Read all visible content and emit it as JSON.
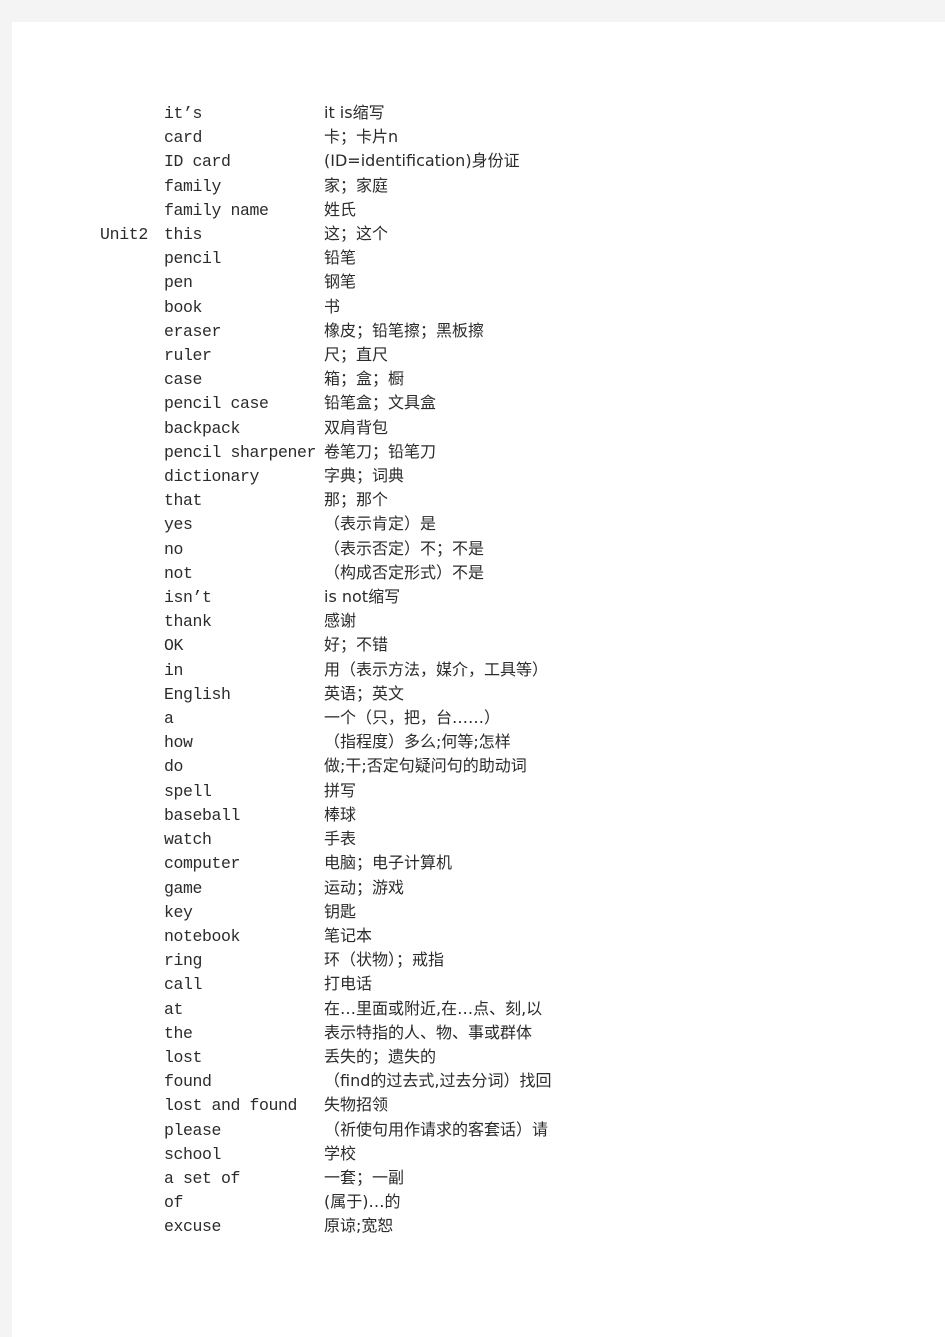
{
  "document": {
    "type": "vocabulary-list",
    "columns": [
      "unit",
      "word",
      "meaning"
    ],
    "page_background": "#ffffff",
    "surround_background": "#f4f4f4",
    "text_color": "#2b2b2b"
  },
  "rows": [
    {
      "unit": "",
      "word": "it’s",
      "meaning": "it is缩写"
    },
    {
      "unit": "",
      "word": "card",
      "meaning": "卡；卡片n"
    },
    {
      "unit": "",
      "word": "ID card",
      "meaning": "(ID=identification)身份证"
    },
    {
      "unit": "",
      "word": "family",
      "meaning": "家；家庭"
    },
    {
      "unit": "",
      "word": "family name",
      "meaning": "姓氏"
    },
    {
      "unit": "Unit2",
      "word": "this",
      "meaning": "这；这个"
    },
    {
      "unit": "",
      "word": "pencil",
      "meaning": "铅笔"
    },
    {
      "unit": "",
      "word": "pen",
      "meaning": "钢笔"
    },
    {
      "unit": "",
      "word": "book",
      "meaning": "书"
    },
    {
      "unit": "",
      "word": "eraser",
      "meaning": "橡皮；铅笔擦；黑板擦"
    },
    {
      "unit": "",
      "word": "ruler",
      "meaning": "尺；直尺"
    },
    {
      "unit": "",
      "word": "case",
      "meaning": "箱；盒；橱"
    },
    {
      "unit": "",
      "word": "pencil case",
      "meaning": "铅笔盒；文具盒"
    },
    {
      "unit": "",
      "word": "backpack",
      "meaning": "双肩背包"
    },
    {
      "unit": "",
      "word": "pencil sharpener",
      "meaning": "卷笔刀；铅笔刀"
    },
    {
      "unit": "",
      "word": "dictionary",
      "meaning": "字典；词典"
    },
    {
      "unit": "",
      "word": "that",
      "meaning": "那；那个"
    },
    {
      "unit": "",
      "word": "yes",
      "meaning": "（表示肯定）是"
    },
    {
      "unit": "",
      "word": "no",
      "meaning": "（表示否定）不；不是"
    },
    {
      "unit": "",
      "word": "not",
      "meaning": "（构成否定形式）不是"
    },
    {
      "unit": "",
      "word": "isn’t",
      "meaning": "is not缩写"
    },
    {
      "unit": "",
      "word": "thank",
      "meaning": "感谢"
    },
    {
      "unit": "",
      "word": "OK",
      "meaning": "好；不错"
    },
    {
      "unit": "",
      "word": "in",
      "meaning": "用（表示方法，媒介，工具等）"
    },
    {
      "unit": "",
      "word": "English",
      "meaning": "英语；英文"
    },
    {
      "unit": "",
      "word": "a",
      "meaning": "一个（只，把，台……）"
    },
    {
      "unit": "",
      "word": "how",
      "meaning": "（指程度）多么;何等;怎样"
    },
    {
      "unit": "",
      "word": "do",
      "meaning": "做;干;否定句疑问句的助动词"
    },
    {
      "unit": "",
      "word": "spell",
      "meaning": "拼写"
    },
    {
      "unit": "",
      "word": "baseball",
      "meaning": "棒球"
    },
    {
      "unit": "",
      "word": "watch",
      "meaning": "手表"
    },
    {
      "unit": "",
      "word": "computer",
      "meaning": "电脑；电子计算机"
    },
    {
      "unit": "",
      "word": "game",
      "meaning": "运动；游戏"
    },
    {
      "unit": "",
      "word": "key",
      "meaning": "钥匙"
    },
    {
      "unit": "",
      "word": "notebook",
      "meaning": "笔记本"
    },
    {
      "unit": "",
      "word": "ring",
      "meaning": "环（状物）；戒指"
    },
    {
      "unit": "",
      "word": "call",
      "meaning": "打电话"
    },
    {
      "unit": "",
      "word": "at",
      "meaning": "在…里面或附近,在…点、刻,以"
    },
    {
      "unit": "",
      "word": "the",
      "meaning": "表示特指的人、物、事或群体"
    },
    {
      "unit": "",
      "word": "lost",
      "meaning": "丢失的；遗失的"
    },
    {
      "unit": "",
      "word": "found",
      "meaning": "（find的过去式,过去分词）找回"
    },
    {
      "unit": "",
      "word": "lost and found",
      "meaning": "失物招领"
    },
    {
      "unit": "",
      "word": "please",
      "meaning": "（祈使句用作请求的客套话）请"
    },
    {
      "unit": "",
      "word": "school",
      "meaning": "学校"
    },
    {
      "unit": "",
      "word": "a set of",
      "meaning": "一套；一副"
    },
    {
      "unit": "",
      "word": "of",
      "meaning": "(属于)…的"
    },
    {
      "unit": "",
      "word": "excuse",
      "meaning": "原谅;宽恕"
    }
  ]
}
